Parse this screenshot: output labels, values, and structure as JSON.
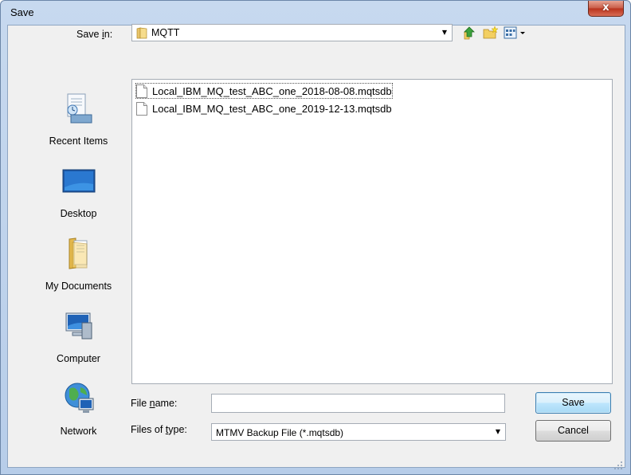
{
  "window": {
    "title": "Save",
    "close_glyph": "x"
  },
  "save_in": {
    "label": "Save in:",
    "value": "MQTT",
    "folder_icon": "folder-icon"
  },
  "toolbar": {
    "icons": [
      "up-one-level-icon",
      "create-new-folder-icon",
      "view-menu-icon"
    ]
  },
  "places": [
    {
      "label": "Recent Items",
      "icon": "recent-items-icon"
    },
    {
      "label": "Desktop",
      "icon": "desktop-icon"
    },
    {
      "label": "My Documents",
      "icon": "my-documents-icon"
    },
    {
      "label": "Computer",
      "icon": "computer-icon"
    },
    {
      "label": "Network",
      "icon": "network-icon"
    }
  ],
  "files": [
    {
      "name": "Local_IBM_MQ_test_ABC_one_2018-08-08.mqtsdb"
    },
    {
      "name": "Local_IBM_MQ_test_ABC_one_2019-12-13.mqtsdb"
    }
  ],
  "file_name": {
    "label": "File name:",
    "value": ""
  },
  "files_of_type": {
    "label": "Files of type:",
    "value": "MTMV Backup File (*.mqtsdb)"
  },
  "buttons": {
    "save": "Save",
    "cancel": "Cancel"
  },
  "colors": {
    "frame": "#b7cde9",
    "close_button": "#c85a45",
    "default_button_border": "#3c7fb1"
  }
}
